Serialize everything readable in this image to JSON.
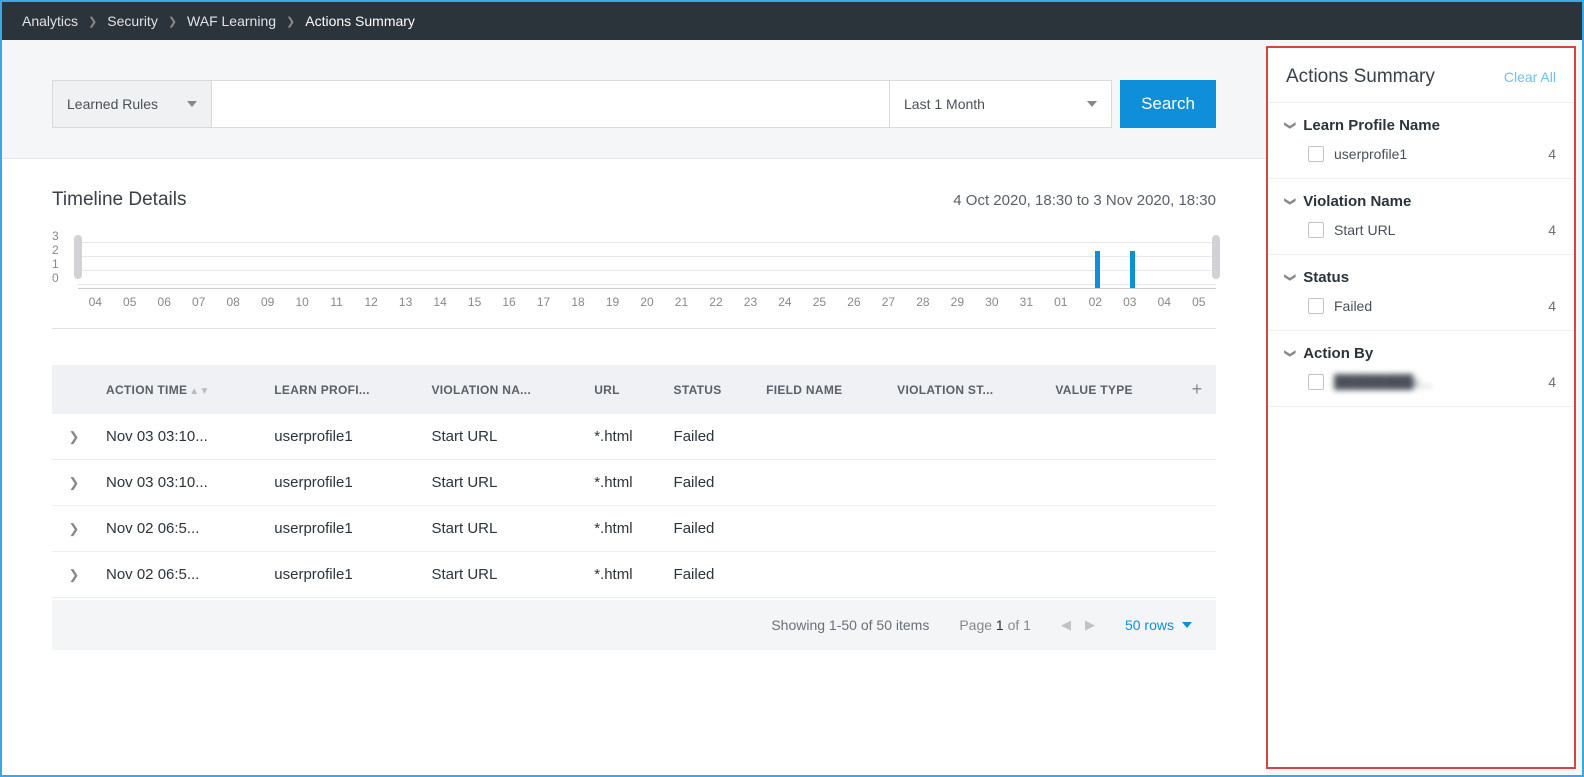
{
  "breadcrumb": [
    "Analytics",
    "Security",
    "WAF Learning",
    "Actions Summary"
  ],
  "searchbar": {
    "left_dropdown": "Learned Rules",
    "search_placeholder": "",
    "right_dropdown": "Last 1 Month",
    "search_button": "Search"
  },
  "timeline": {
    "title": "Timeline Details",
    "range": "4 Oct 2020, 18:30 to 3 Nov 2020, 18:30"
  },
  "chart_data": {
    "type": "bar-timeline",
    "ylabel": "",
    "ylim": [
      0,
      3
    ],
    "yticks": [
      0,
      1,
      2,
      3
    ],
    "categories": [
      "04",
      "05",
      "06",
      "07",
      "08",
      "09",
      "10",
      "11",
      "12",
      "13",
      "14",
      "15",
      "16",
      "17",
      "18",
      "19",
      "20",
      "21",
      "22",
      "23",
      "24",
      "25",
      "26",
      "27",
      "28",
      "29",
      "30",
      "31",
      "01",
      "02",
      "03",
      "04",
      "05"
    ],
    "values": [
      0,
      0,
      0,
      0,
      0,
      0,
      0,
      0,
      0,
      0,
      0,
      0,
      0,
      0,
      0,
      0,
      0,
      0,
      0,
      0,
      0,
      0,
      0,
      0,
      0,
      0,
      0,
      0,
      0,
      2,
      2,
      0,
      0
    ]
  },
  "table": {
    "columns": [
      "ACTION TIME",
      "LEARN PROFI...",
      "VIOLATION NA...",
      "URL",
      "STATUS",
      "FIELD NAME",
      "VIOLATION ST...",
      "VALUE TYPE"
    ],
    "rows": [
      {
        "action_time": "Nov 03 03:10...",
        "learn_profile": "userprofile1",
        "violation_name": "Start URL",
        "url": "*.html",
        "status": "Failed",
        "field_name": "",
        "violation_st": "",
        "value_type": ""
      },
      {
        "action_time": "Nov 03 03:10...",
        "learn_profile": "userprofile1",
        "violation_name": "Start URL",
        "url": "*.html",
        "status": "Failed",
        "field_name": "",
        "violation_st": "",
        "value_type": ""
      },
      {
        "action_time": "Nov 02 06:5...",
        "learn_profile": "userprofile1",
        "violation_name": "Start URL",
        "url": "*.html",
        "status": "Failed",
        "field_name": "",
        "violation_st": "",
        "value_type": ""
      },
      {
        "action_time": "Nov 02 06:5...",
        "learn_profile": "userprofile1",
        "violation_name": "Start URL",
        "url": "*.html",
        "status": "Failed",
        "field_name": "",
        "violation_st": "",
        "value_type": ""
      }
    ],
    "footer": {
      "showing": "Showing 1-50 of 50 items",
      "page_prefix": "Page ",
      "page_current": "1",
      "page_of": " of 1",
      "rows_label": "50 rows"
    }
  },
  "panel": {
    "title": "Actions Summary",
    "clear": "Clear All",
    "facets": [
      {
        "name": "Learn Profile Name",
        "items": [
          {
            "label": "userprofile1",
            "count": 4
          }
        ]
      },
      {
        "name": "Violation Name",
        "items": [
          {
            "label": "Start URL",
            "count": 4
          }
        ]
      },
      {
        "name": "Status",
        "items": [
          {
            "label": "Failed",
            "count": 4
          }
        ]
      },
      {
        "name": "Action By",
        "items": [
          {
            "label": "████████c...",
            "count": 4,
            "blur": true
          }
        ]
      }
    ]
  }
}
